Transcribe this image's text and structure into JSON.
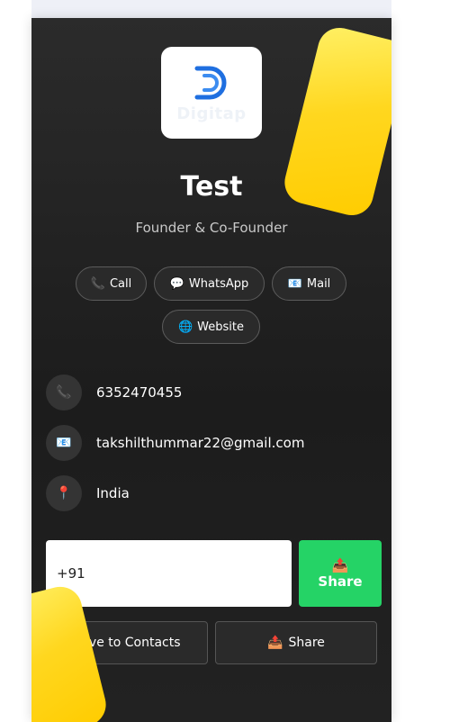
{
  "card": {
    "logo_text": "Digitap",
    "name": "Test",
    "role": "Founder & Co-Founder"
  },
  "actions": [
    {
      "icon": "📞",
      "label": "Call"
    },
    {
      "icon": "💬",
      "label": "WhatsApp"
    },
    {
      "icon": "📧",
      "label": "Mail"
    },
    {
      "icon": "🌐",
      "label": "Website"
    }
  ],
  "contact": {
    "phone_icon": "📞",
    "phone": "6352470455",
    "email_icon": "📧",
    "email": "takshilthummar22@gmail.com",
    "location_icon": "📍",
    "location": "India"
  },
  "share_form": {
    "phone_value": "+91",
    "share_icon": "📤",
    "share_label": "Share"
  },
  "footer": {
    "save_label": "Save to Contacts",
    "share_icon": "📤",
    "share_label": "Share"
  },
  "colors": {
    "card_bg": "#222222",
    "accent_yellow": "#ffd71f",
    "whatsapp_green": "#25d366",
    "logo_blue": "#1f6fe0"
  }
}
